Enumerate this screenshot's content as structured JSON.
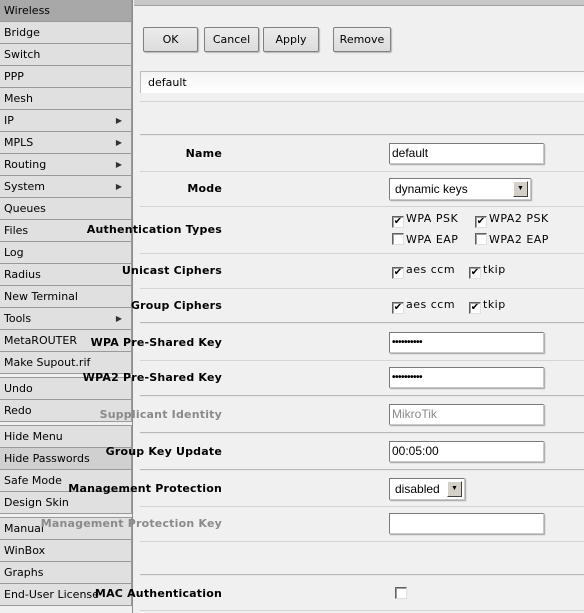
{
  "sidebar": {
    "groups": [
      [
        {
          "label": "Wireless",
          "state": "active"
        },
        {
          "label": "Bridge"
        },
        {
          "label": "Switch"
        },
        {
          "label": "PPP"
        },
        {
          "label": "Mesh"
        },
        {
          "label": "IP",
          "submenu": true
        },
        {
          "label": "MPLS",
          "submenu": true
        },
        {
          "label": "Routing",
          "submenu": true
        },
        {
          "label": "System",
          "submenu": true
        },
        {
          "label": "Queues"
        },
        {
          "label": "Files"
        },
        {
          "label": "Log"
        },
        {
          "label": "Radius"
        },
        {
          "label": "New Terminal"
        },
        {
          "label": "Tools",
          "submenu": true
        },
        {
          "label": "MetaROUTER"
        },
        {
          "label": "Make Supout.rif"
        }
      ],
      [
        {
          "label": "Undo"
        },
        {
          "label": "Redo"
        }
      ],
      [
        {
          "label": "Hide Menu"
        },
        {
          "label": "Hide Passwords",
          "state": "highlight"
        },
        {
          "label": "Safe Mode"
        },
        {
          "label": "Design Skin"
        }
      ],
      [
        {
          "label": "Manual"
        },
        {
          "label": "WinBox"
        },
        {
          "label": "Graphs"
        },
        {
          "label": "End-User License"
        }
      ]
    ],
    "submenu_arrow": "▶"
  },
  "toolbar": {
    "ok_label": "OK",
    "cancel_label": "Cancel",
    "apply_label": "Apply",
    "remove_label": "Remove"
  },
  "record_title": "default",
  "form": {
    "name": {
      "label": "Name",
      "value": "default"
    },
    "mode": {
      "label": "Mode",
      "value": "dynamic keys"
    },
    "auth_types": {
      "label": "Authentication Types",
      "options": [
        {
          "label": "WPA PSK",
          "checked": true
        },
        {
          "label": "WPA2 PSK",
          "checked": true
        },
        {
          "label": "WPA EAP",
          "checked": false
        },
        {
          "label": "WPA2 EAP",
          "checked": false
        }
      ]
    },
    "unicast_ciphers": {
      "label": "Unicast Ciphers",
      "options": [
        {
          "label": "aes ccm",
          "checked": true
        },
        {
          "label": "tkip",
          "checked": true
        }
      ]
    },
    "group_ciphers": {
      "label": "Group Ciphers",
      "options": [
        {
          "label": "aes ccm",
          "checked": true
        },
        {
          "label": "tkip",
          "checked": true
        }
      ]
    },
    "wpa_psk": {
      "label": "WPA Pre-Shared Key",
      "value": "••••••••••"
    },
    "wpa2_psk": {
      "label": "WPA2 Pre-Shared Key",
      "value": "••••••••••"
    },
    "supplicant_identity": {
      "label": "Supplicant Identity",
      "value": "MikroTik"
    },
    "group_key_update": {
      "label": "Group Key Update",
      "value": "00:05:00"
    },
    "mgmt_protection": {
      "label": "Management Protection",
      "value": "disabled"
    },
    "mgmt_protection_key": {
      "label": "Management Protection Key",
      "value": ""
    },
    "mac_auth": {
      "label": "MAC Authentication",
      "checked": false
    }
  },
  "icons": {
    "dropdown": "▼",
    "check": "✔"
  }
}
